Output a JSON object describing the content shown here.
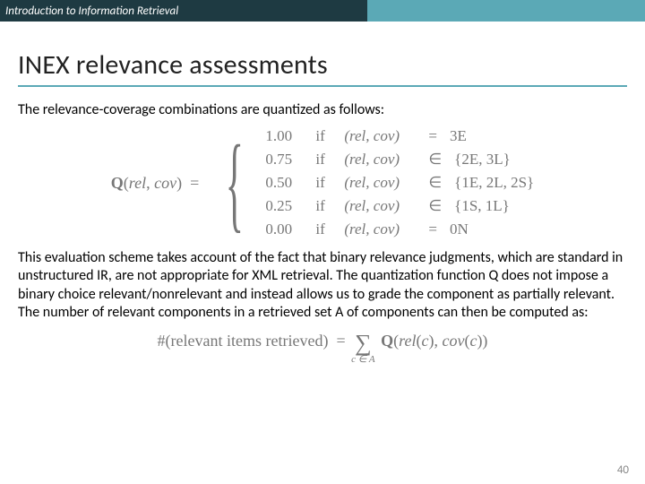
{
  "header": {
    "course": "Introduction to Information Retrieval"
  },
  "title": "INEX relevance assessments",
  "lead": "The relevance-coverage combinations are quantized as follows:",
  "equation1": {
    "lhs": "Q(rel, cov) =",
    "cases": [
      {
        "value": "1.00",
        "word": "if",
        "cond": "(rel, cov)",
        "op": "=",
        "rhs": "3E"
      },
      {
        "value": "0.75",
        "word": "if",
        "cond": "(rel, cov)",
        "op": "∈",
        "rhs": "{2E, 3L}"
      },
      {
        "value": "0.50",
        "word": "if",
        "cond": "(rel, cov)",
        "op": "∈",
        "rhs": "{1E, 2L, 2S}"
      },
      {
        "value": "0.25",
        "word": "if",
        "cond": "(rel, cov)",
        "op": "∈",
        "rhs": "{1S, 1L}"
      },
      {
        "value": "0.00",
        "word": "if",
        "cond": "(rel, cov)",
        "op": "=",
        "rhs": "0N"
      }
    ]
  },
  "paragraph": "This evaluation scheme takes account of the fact that binary relevance judgments, which are standard in unstructured IR, are not appropriate for XML retrieval. The quantization function Q does not impose a binary choice relevant/nonrelevant and instead allows us to grade the component as partially relevant. The number of relevant components in a retrieved set A of components can then be computed as:",
  "equation2": {
    "lhs": "#(relevant items retrieved) =",
    "sum_sub": "c ∈ A",
    "rhs": "Q(rel(c), cov(c))"
  },
  "page_number": "40"
}
